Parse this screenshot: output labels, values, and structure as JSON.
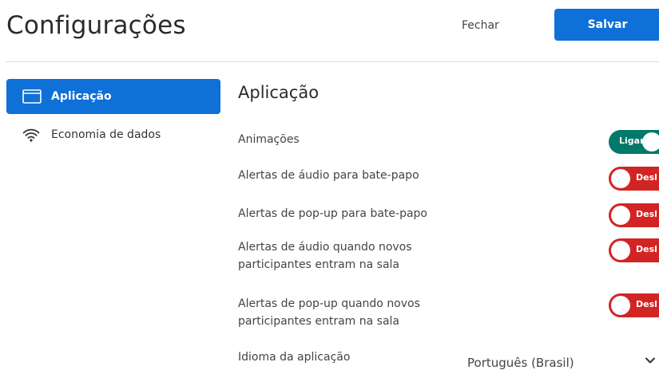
{
  "header": {
    "title": "Configurações",
    "close_label": "Fechar",
    "save_label": "Salvar"
  },
  "sidebar": {
    "items": [
      {
        "label": "Aplicação",
        "icon": "application-window-icon",
        "active": true
      },
      {
        "label": "Economia de dados",
        "icon": "wifi-icon",
        "active": false
      }
    ]
  },
  "main": {
    "section_title": "Aplicação",
    "settings": [
      {
        "label": "Animações",
        "state": "on",
        "toggle_text": "Ligar"
      },
      {
        "label": "Alertas de áudio para bate-papo",
        "state": "off",
        "toggle_text": "Desl"
      },
      {
        "label": "Alertas de pop-up para bate-papo",
        "state": "off",
        "toggle_text": "Desl"
      },
      {
        "label": "Alertas de áudio quando novos participantes entram na sala",
        "state": "off",
        "toggle_text": "Desl"
      },
      {
        "label": "Alertas de pop-up quando novos participantes entram na sala",
        "state": "off",
        "toggle_text": "Desl"
      }
    ],
    "language": {
      "label": "Idioma da aplicação",
      "value": "Português (Brasil)"
    }
  },
  "colors": {
    "primary": "#0f70d7",
    "toggle_on": "#00796b",
    "toggle_off": "#d32424"
  }
}
